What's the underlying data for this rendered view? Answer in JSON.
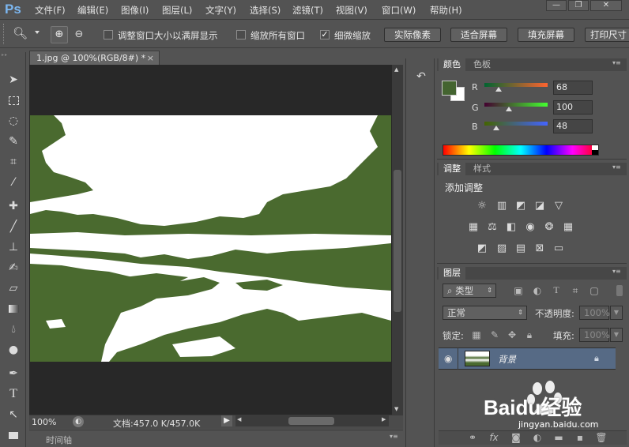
{
  "app": {
    "logo": "Ps"
  },
  "menu": [
    "文件(F)",
    "编辑(E)",
    "图像(I)",
    "图层(L)",
    "文字(Y)",
    "选择(S)",
    "滤镜(T)",
    "视图(V)",
    "窗口(W)",
    "帮助(H)"
  ],
  "window_controls": {
    "minimize": "—",
    "restore": "❐",
    "close": "✕"
  },
  "options": {
    "resize_windows": {
      "label": "调整窗口大小以满屏显示",
      "checked": false
    },
    "zoom_all_windows": {
      "label": "缩放所有窗口",
      "checked": false
    },
    "scrubby_zoom": {
      "label": "细微缩放",
      "checked": true
    },
    "buttons": [
      "实际像素",
      "适合屏幕",
      "填充屏幕",
      "打印尺寸"
    ]
  },
  "document": {
    "tab_title": "1.jpg @ 100%(RGB/8#) *",
    "zoom": "100%",
    "doc_size": "文档:457.0 K/457.0K",
    "timeline_label": "时间轴"
  },
  "color_panel": {
    "tabs": [
      "颜色",
      "色板"
    ],
    "r_label": "R",
    "g_label": "G",
    "b_label": "B",
    "r": "68",
    "g": "100",
    "b": "48",
    "foreground_color": "#446430",
    "background_color": "#ffffff"
  },
  "adjust_panel": {
    "tabs": [
      "调整",
      "样式"
    ],
    "title": "添加调整"
  },
  "layers_panel": {
    "tab": "图层",
    "filter_kind": "类型",
    "blend_mode": "正常",
    "opacity_label": "不透明度:",
    "opacity_value": "100%",
    "lock_label": "锁定:",
    "fill_label": "填充:",
    "fill_value": "100%",
    "layer_name": "背景"
  },
  "watermark": {
    "brand": "Baidu经验",
    "url": "jingyan.baidu.com"
  },
  "colors": {
    "image_green": "#4a6a2f",
    "panel_bg": "#535353"
  }
}
